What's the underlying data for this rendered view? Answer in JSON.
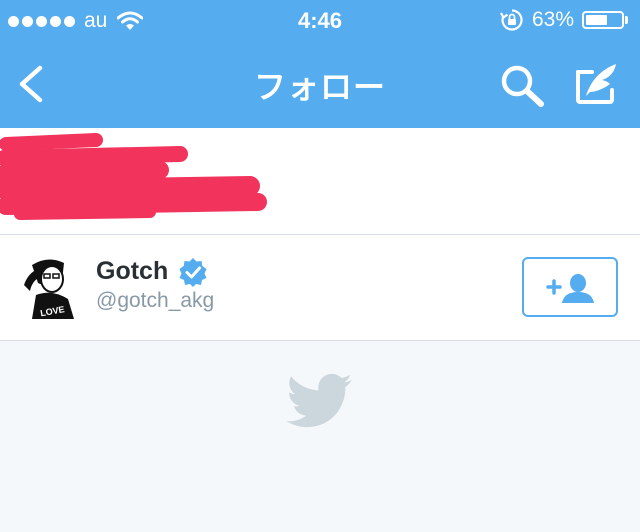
{
  "status_bar": {
    "carrier": "au",
    "time": "4:46",
    "battery_percent": "63%",
    "battery_level": 0.63
  },
  "navbar": {
    "title": "フォロー",
    "icons": {
      "back": "chevron-left-icon",
      "search": "search-icon",
      "compose": "compose-tweet-icon"
    }
  },
  "following_list": [
    {
      "name": "Gotch",
      "handle": "@gotch_akg",
      "verified": true,
      "avatar_text": "LOVE"
    }
  ],
  "colors": {
    "brand_blue": "#55acee",
    "redaction": "#f2335c",
    "bird_watermark": "#ccd6dd"
  }
}
